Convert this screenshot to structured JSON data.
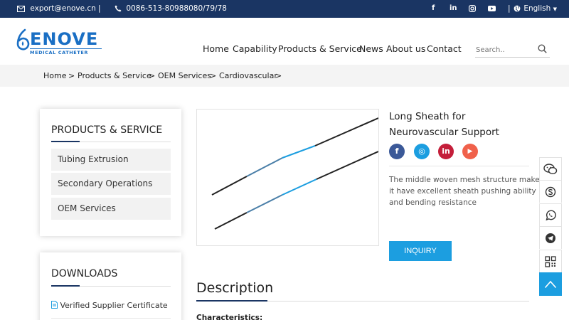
{
  "topbar": {
    "email": "export@enove.cn",
    "divider": "|",
    "phone": "0086-513-80988080/79/78",
    "social": [
      "f",
      "in",
      "instagram",
      "youtube"
    ],
    "language_divider": "|",
    "language": "English"
  },
  "logo": {
    "name": "ENOVE",
    "tagline": "MEDICAL CATHETER"
  },
  "nav": [
    "Home",
    "Capability",
    "Products & Service",
    "News",
    "About us",
    "Contact"
  ],
  "search": {
    "placeholder": "Search.."
  },
  "breadcrumb": {
    "items": [
      "Home",
      "Products & Service",
      "OEM Services",
      "Cardiovascular"
    ],
    "separator": ">"
  },
  "sidebar": {
    "products_title": "PRODUCTS & SERVICE",
    "products": [
      "Tubing Extrusion",
      "Secondary Operations",
      "OEM Services"
    ],
    "downloads_title": "DOWNLOADS",
    "downloads": [
      "Verified Supplier Certificate"
    ]
  },
  "product": {
    "title_line1": "Long Sheath for",
    "title_line2": "Neurovascular Support",
    "share": [
      {
        "icon": "facebook-icon",
        "letter": "f",
        "color": "#3b5998"
      },
      {
        "icon": "instagram-icon",
        "letter": "◎",
        "color": "#1c9ee0"
      },
      {
        "icon": "linkedin-icon",
        "letter": "in",
        "color": "#c41e3a"
      },
      {
        "icon": "youtube-icon",
        "letter": "▶",
        "color": "#f0614b"
      }
    ],
    "desc_line1": "The middle woven mesh structure makes",
    "desc_line2": "it have excellent sheath pushing ability",
    "desc_line3": "and bending resistance",
    "inquiry": "INQUIRY"
  },
  "description": {
    "heading": "Description",
    "characteristics": "Characteristics:"
  },
  "floating": [
    "wechat-icon",
    "skype-icon",
    "whatsapp-icon",
    "telegram-icon",
    "qrcode-icon",
    "back-to-top-icon"
  ],
  "colors": {
    "navy": "#1a3563",
    "accent": "#1c9ee0",
    "gray_bg": "#f4f4f4"
  }
}
